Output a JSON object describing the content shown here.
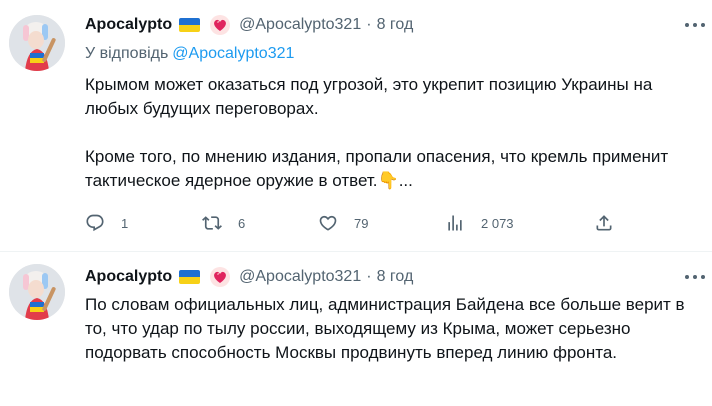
{
  "tweets": [
    {
      "author_name": "Apocalypto",
      "handle": "@Apocalypto321",
      "separator": "·",
      "time": "8 год",
      "reply_prefix": "У відповідь",
      "reply_handle": "@Apocalypto321",
      "paragraphs": [
        "Крымом может оказаться под угрозой, это укрепит позицию Украины на любых будущих переговорах.",
        "Кроме того, по мнению издания, пропали опасения, что кремль применит тактическое ядерное оружие в ответ."
      ],
      "trailing_emoji": "👇",
      "truncation": "...",
      "actions": {
        "reply_count": "1",
        "retweet_count": "6",
        "like_count": "79",
        "views_count": "2 073"
      }
    },
    {
      "author_name": "Apocalypto",
      "handle": "@Apocalypto321",
      "separator": "·",
      "time": "8 год",
      "paragraphs": [
        "По словам официальных лиц, администрация Байдена все больше верит в то, что удар по тылу россии, выходящему из Крыма, может серьезно подорвать способность Москвы продвинуть вперед линию фронта."
      ]
    }
  ],
  "icons": {
    "reply": "reply-icon",
    "retweet": "retweet-icon",
    "like": "heart-icon",
    "views": "views-icon",
    "share": "share-icon",
    "more": "more-icon",
    "flag": "ukraine-flag-icon",
    "badge": "red-heart-badge-icon"
  },
  "colors": {
    "text": "#0f1419",
    "secondary": "#536471",
    "link": "#1d9bf0",
    "divider": "#eff3f4",
    "flag_blue": "#1f70d1",
    "flag_yellow": "#f7d117"
  }
}
